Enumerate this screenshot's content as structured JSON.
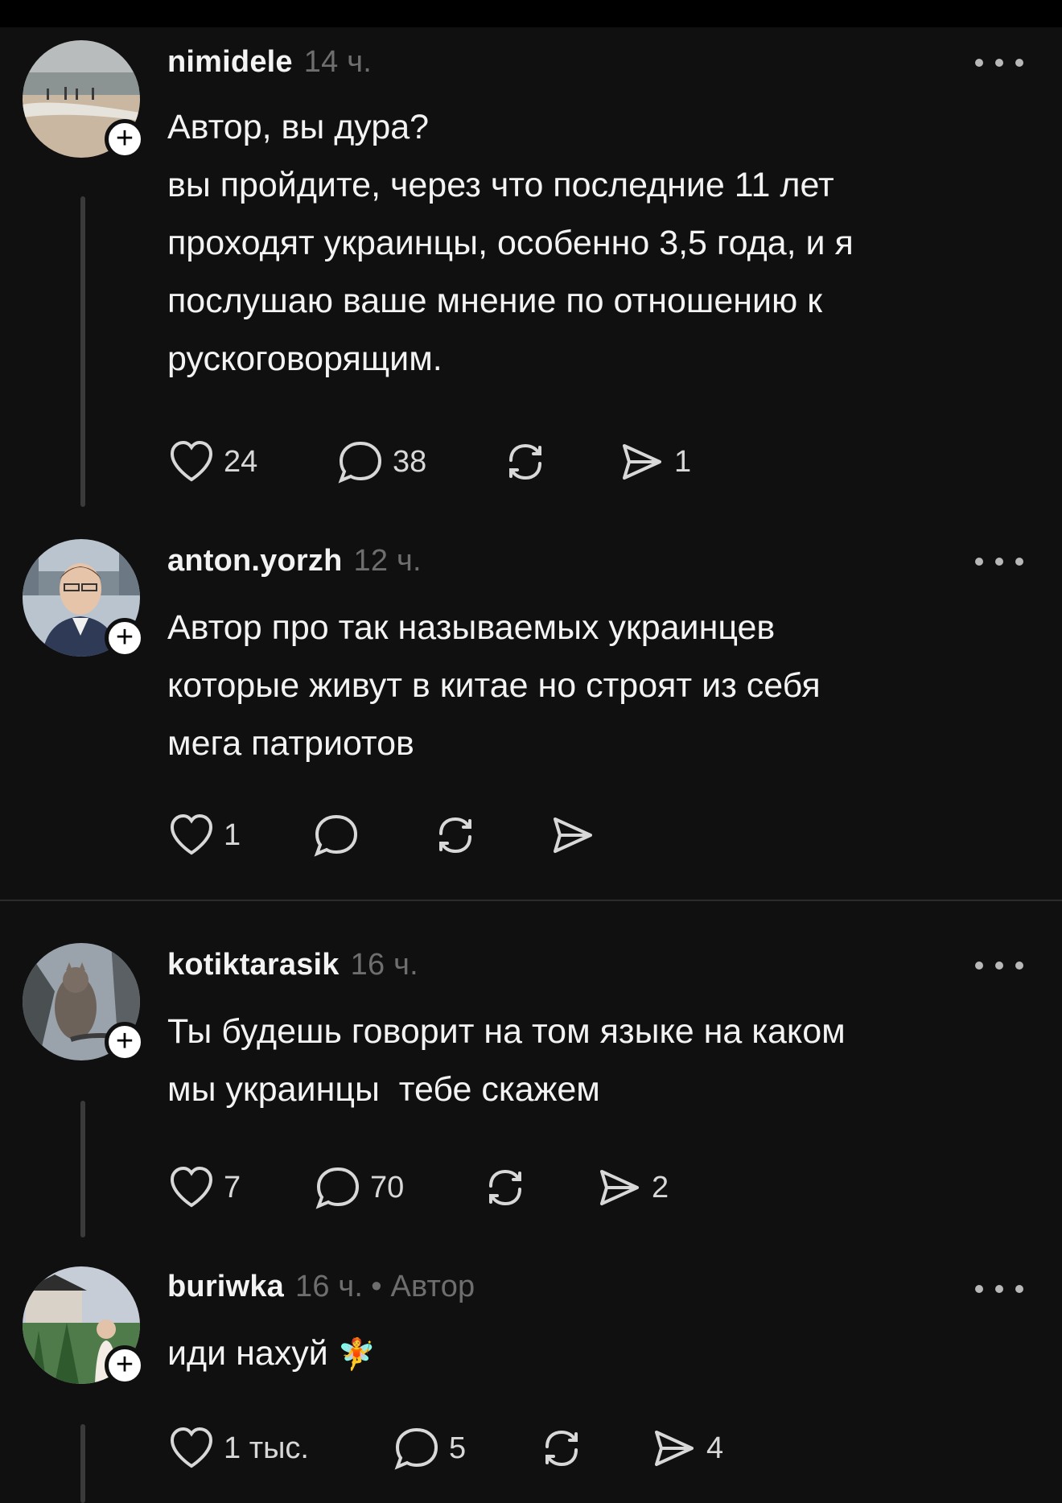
{
  "comments": [
    {
      "username": "nimidele",
      "time": "14 ч.",
      "meta_extra": "",
      "lines": [
        "Автор, вы дура?",
        "вы пройдите, через что последние 11 лет",
        "проходят украинцы, особенно 3,5 года, и я",
        "послушаю ваше мнение по отношению к",
        "рускоговорящим."
      ],
      "likes": "24",
      "replies": "38",
      "shares": "1",
      "avatar_icon": "beach-photo-avatar"
    },
    {
      "username": "anton.yorzh",
      "time": "12 ч.",
      "meta_extra": "",
      "lines": [
        "Автор про так называемых украинцев",
        "которые живут в китае но строят из себя",
        "мега патриотов"
      ],
      "likes": "1",
      "replies": "",
      "shares": "",
      "avatar_icon": "man-in-suit-avatar"
    },
    {
      "username": "kotiktarasik",
      "time": "16 ч.",
      "meta_extra": "",
      "lines": [
        "Ты будешь говорит на том языке на каком",
        "мы украинцы  тебе скажем"
      ],
      "likes": "7",
      "replies": "70",
      "shares": "2",
      "avatar_icon": "cat-in-tree-avatar"
    },
    {
      "username": "buriwka",
      "time": "16 ч.",
      "meta_extra": "• Автор",
      "lines": [
        "иди нахуй"
      ],
      "emoji": "🧚",
      "likes": "1 тыс.",
      "replies": "5",
      "shares": "4",
      "avatar_icon": "temple-garden-avatar"
    }
  ],
  "follow_symbol": "+",
  "colors": {
    "background": "#101010",
    "text": "#f3f3f3",
    "muted": "#6e6e6e",
    "divider": "#2c2c2c"
  }
}
